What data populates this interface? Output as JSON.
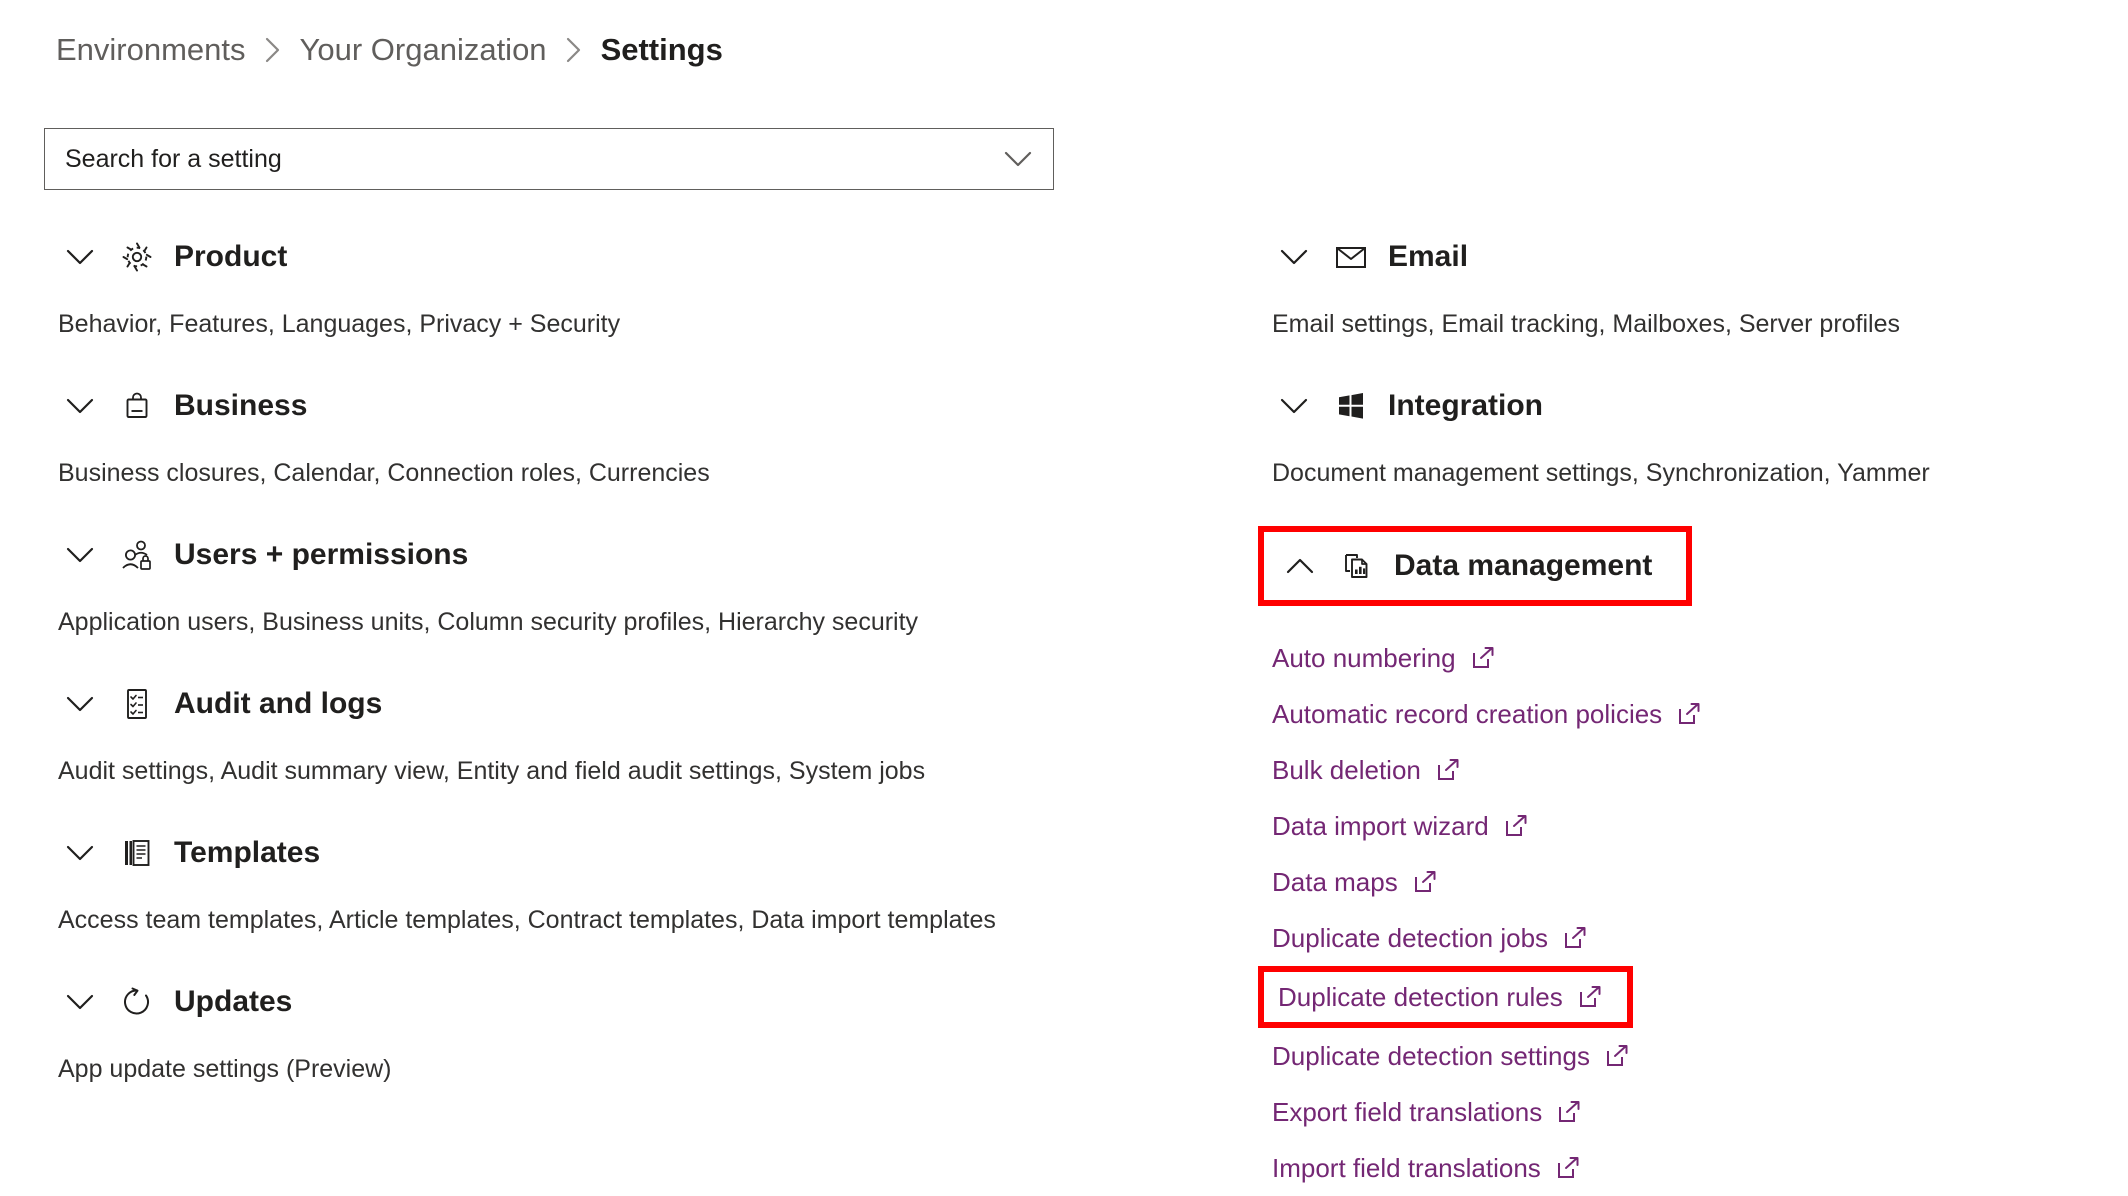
{
  "breadcrumb": {
    "items": [
      {
        "label": "Environments",
        "current": false
      },
      {
        "label": "Your Organization",
        "current": false
      },
      {
        "label": "Settings",
        "current": true
      }
    ],
    "separator_icon": "chevron-right-icon"
  },
  "search": {
    "placeholder": "Search for a setting",
    "value": "",
    "chevron_icon": "chevron-down-icon"
  },
  "colors": {
    "link": "#742774",
    "highlight": "#ff0000",
    "text": "#201f1e",
    "muted": "#605e5c"
  },
  "left_column": {
    "groups": [
      {
        "title": "Product",
        "icon": "gear-icon",
        "chevron": "chevron-down-icon",
        "expanded": false,
        "subtitle": "Behavior, Features, Languages, Privacy + Security"
      },
      {
        "title": "Business",
        "icon": "briefcase-icon",
        "chevron": "chevron-down-icon",
        "expanded": false,
        "subtitle": "Business closures, Calendar, Connection roles, Currencies"
      },
      {
        "title": "Users + permissions",
        "icon": "users-lock-icon",
        "chevron": "chevron-down-icon",
        "expanded": false,
        "subtitle": "Application users, Business units, Column security profiles, Hierarchy security"
      },
      {
        "title": "Audit and logs",
        "icon": "checklist-icon",
        "chevron": "chevron-down-icon",
        "expanded": false,
        "subtitle": "Audit settings, Audit summary view, Entity and field audit settings, System jobs"
      },
      {
        "title": "Templates",
        "icon": "documents-stack-icon",
        "chevron": "chevron-down-icon",
        "expanded": false,
        "subtitle": "Access team templates, Article templates, Contract templates, Data import templates"
      },
      {
        "title": "Updates",
        "icon": "refresh-icon",
        "chevron": "chevron-down-icon",
        "expanded": false,
        "subtitle": "App update settings (Preview)"
      }
    ]
  },
  "right_column": {
    "groups": [
      {
        "title": "Email",
        "icon": "envelope-icon",
        "chevron": "chevron-down-icon",
        "expanded": false,
        "subtitle": "Email settings, Email tracking, Mailboxes, Server profiles"
      },
      {
        "title": "Integration",
        "icon": "windows-grid-icon",
        "chevron": "chevron-down-icon",
        "expanded": false,
        "subtitle": "Document management settings, Synchronization, Yammer"
      },
      {
        "title": "Data management",
        "icon": "data-report-icon",
        "chevron": "chevron-up-icon",
        "expanded": true,
        "highlighted": true,
        "links": [
          {
            "label": "Auto numbering",
            "icon": "external-link-icon",
            "highlighted": false
          },
          {
            "label": "Automatic record creation policies",
            "icon": "external-link-icon",
            "highlighted": false
          },
          {
            "label": "Bulk deletion",
            "icon": "external-link-icon",
            "highlighted": false
          },
          {
            "label": "Data import wizard",
            "icon": "external-link-icon",
            "highlighted": false
          },
          {
            "label": "Data maps",
            "icon": "external-link-icon",
            "highlighted": false
          },
          {
            "label": "Duplicate detection jobs",
            "icon": "external-link-icon",
            "highlighted": false
          },
          {
            "label": "Duplicate detection rules",
            "icon": "external-link-icon",
            "highlighted": true
          },
          {
            "label": "Duplicate detection settings",
            "icon": "external-link-icon",
            "highlighted": false
          },
          {
            "label": "Export field translations",
            "icon": "external-link-icon",
            "highlighted": false
          },
          {
            "label": "Import field translations",
            "icon": "external-link-icon",
            "highlighted": false
          }
        ]
      }
    ]
  }
}
